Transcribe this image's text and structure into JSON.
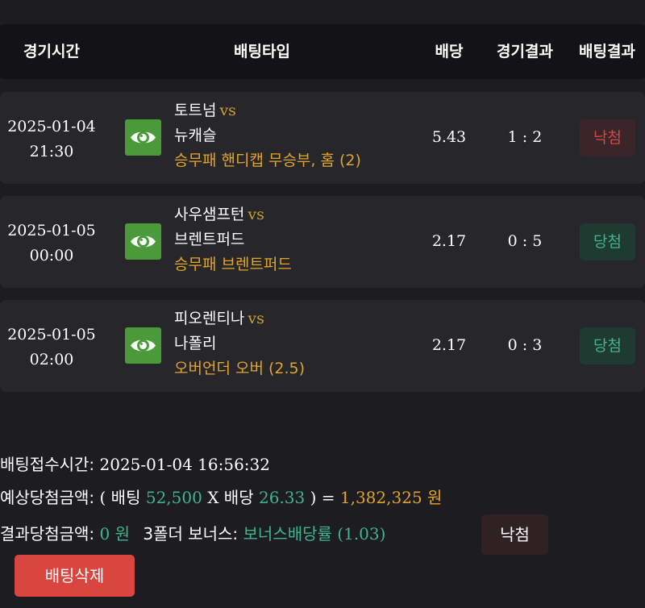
{
  "header": {
    "time_label": "경기시간",
    "type_label": "배팅타입",
    "odds_label": "배당",
    "result_label": "경기결과",
    "bet_result_label": "배팅결과"
  },
  "rows": [
    {
      "date": "2025-01-04",
      "time": "21:30",
      "home": "토트넘",
      "vs": "vs",
      "away": "뉴캐슬",
      "pick": "승무패 핸디캡 무승부, 홈 (2)",
      "odds": "5.43",
      "score": "1 : 2",
      "result": "낙첨"
    },
    {
      "date": "2025-01-05",
      "time": "00:00",
      "home": "사우샘프턴",
      "vs": "vs",
      "away": "브렌트퍼드",
      "pick": "승무패 브렌트퍼드",
      "odds": "2.17",
      "score": "0 : 5",
      "result": "당첨"
    },
    {
      "date": "2025-01-05",
      "time": "02:00",
      "home": "피오렌티나",
      "vs": "vs",
      "away": "나폴리",
      "pick": "오버언더 오버 (2.5)",
      "odds": "2.17",
      "score": "0 : 3",
      "result": "당첨"
    }
  ],
  "summary": {
    "received_label": "배팅접수시간:",
    "received_value": "2025-01-04 16:56:32",
    "expected_label": "예상당첨금액:",
    "open_paren": "(",
    "bet_label": "배팅",
    "bet_amount": "52,500",
    "times": "X",
    "odds_label": "배당",
    "total_odds": "26.33",
    "close_eq": ") =",
    "expected_amount": "1,382,325 원",
    "actual_label": "결과당첨금액:",
    "actual_amount": "0 원",
    "bonus_label": "3폴더 보너스:",
    "bonus_value": "보너스배당률 (1.03)",
    "result_badge": "낙첨",
    "delete_button": "배팅삭제"
  },
  "colors": {
    "background": "#1d1d21",
    "row_background": "#27272b",
    "accent_gold": "#e2a52a",
    "win_green": "#3fb68a",
    "lose_red": "#d8454b",
    "delete_red": "#d9453f",
    "eye_green": "#4a9a3a"
  },
  "icons": {
    "view_icon": "eye-icon"
  }
}
